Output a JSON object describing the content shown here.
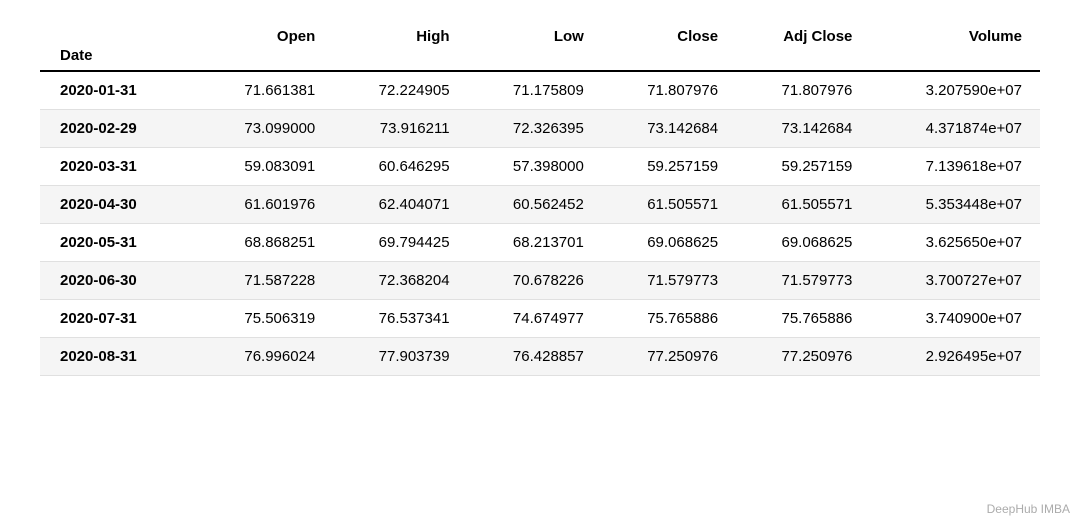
{
  "table": {
    "columns": [
      {
        "key": "date",
        "label": "Date",
        "align": "left"
      },
      {
        "key": "open",
        "label": "Open",
        "align": "right"
      },
      {
        "key": "high",
        "label": "High",
        "align": "right"
      },
      {
        "key": "low",
        "label": "Low",
        "align": "right"
      },
      {
        "key": "close",
        "label": "Close",
        "align": "right"
      },
      {
        "key": "adj_close",
        "label": "Adj Close",
        "align": "right"
      },
      {
        "key": "volume",
        "label": "Volume",
        "align": "right"
      }
    ],
    "rows": [
      {
        "date": "2020-01-31",
        "open": "71.661381",
        "high": "72.224905",
        "low": "71.175809",
        "close": "71.807976",
        "adj_close": "71.807976",
        "volume": "3.207590e+07"
      },
      {
        "date": "2020-02-29",
        "open": "73.099000",
        "high": "73.916211",
        "low": "72.326395",
        "close": "73.142684",
        "adj_close": "73.142684",
        "volume": "4.371874e+07"
      },
      {
        "date": "2020-03-31",
        "open": "59.083091",
        "high": "60.646295",
        "low": "57.398000",
        "close": "59.257159",
        "adj_close": "59.257159",
        "volume": "7.139618e+07"
      },
      {
        "date": "2020-04-30",
        "open": "61.601976",
        "high": "62.404071",
        "low": "60.562452",
        "close": "61.505571",
        "adj_close": "61.505571",
        "volume": "5.353448e+07"
      },
      {
        "date": "2020-05-31",
        "open": "68.868251",
        "high": "69.794425",
        "low": "68.213701",
        "close": "69.068625",
        "adj_close": "69.068625",
        "volume": "3.625650e+07"
      },
      {
        "date": "2020-06-30",
        "open": "71.587228",
        "high": "72.368204",
        "low": "70.678226",
        "close": "71.579773",
        "adj_close": "71.579773",
        "volume": "3.700727e+07"
      },
      {
        "date": "2020-07-31",
        "open": "75.506319",
        "high": "76.537341",
        "low": "74.674977",
        "close": "75.765886",
        "adj_close": "75.765886",
        "volume": "3.740900e+07"
      },
      {
        "date": "2020-08-31",
        "open": "76.996024",
        "high": "77.903739",
        "low": "76.428857",
        "close": "77.250976",
        "adj_close": "77.250976",
        "volume": "2.926495e+07"
      }
    ]
  },
  "watermark": "DeepHub IMBA"
}
